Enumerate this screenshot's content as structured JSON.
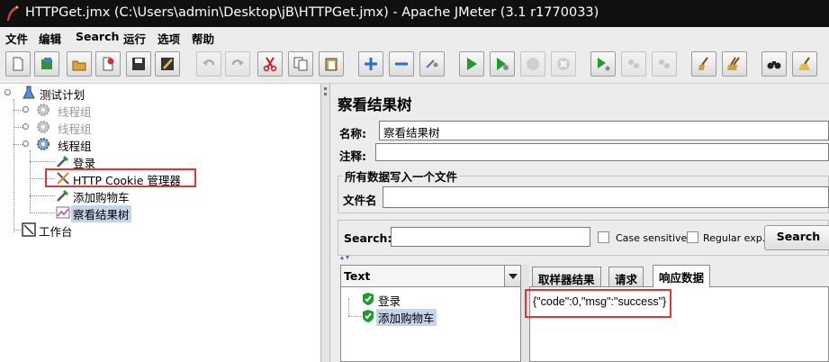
{
  "window": {
    "title": "HTTPGet.jmx (C:\\Users\\admin\\Desktop\\jB\\HTTPGet.jmx) - Apache JMeter (3.1 r1770033)"
  },
  "menu": [
    "文件",
    "编辑",
    "Search",
    "运行",
    "选项",
    "帮助"
  ],
  "toolbar": {
    "buttons": [
      "new-icon",
      "templates-icon",
      "open-icon",
      "close-icon",
      "save-icon",
      "save-as-icon",
      "undo-icon",
      "redo-icon",
      "cut-icon",
      "copy-icon",
      "paste-icon",
      "expand-icon",
      "collapse-icon",
      "toggle-icon",
      "start-icon",
      "start-no-pause-icon",
      "stop-icon",
      "shutdown-icon",
      "remote-start-icon",
      "remote-stop-icon",
      "remote-shutdown-icon",
      "clear-icon",
      "clear-all-icon",
      "search-icon",
      "reset-search-icon"
    ]
  },
  "tree": {
    "root": "测试计划",
    "items": [
      {
        "label": "线程组",
        "disabled": true
      },
      {
        "label": "线程组",
        "disabled": true
      },
      {
        "label": "线程组",
        "disabled": false
      },
      {
        "label": "登录"
      },
      {
        "label": "HTTP Cookie 管理器"
      },
      {
        "label": "添加购物车"
      },
      {
        "label": "察看结果树"
      }
    ],
    "workbench": "工作台"
  },
  "panel": {
    "title": "察看结果树",
    "name_label": "名称:",
    "name_value": "察看结果树",
    "comment_label": "注释:",
    "comment_value": "",
    "file_group_title": "所有数据写入一个文件",
    "filename_label": "文件名",
    "filename_value": ""
  },
  "search": {
    "label": "Search:",
    "value": "",
    "case_sensitive_label": "Case sensitive",
    "regex_label": "Regular exp.",
    "button_label": "Search"
  },
  "results": {
    "renderer": "Text",
    "samples": [
      {
        "label": "登录",
        "status": "success"
      },
      {
        "label": "添加购物车",
        "status": "success"
      }
    ],
    "tabs": [
      "取样器结果",
      "请求",
      "响应数据"
    ],
    "active_tab": "响应数据",
    "response_text": "{\"code\":0,\"msg\":\"success\"}"
  },
  "colors": {
    "highlight_box": "#d93a36",
    "selection": "#c5d4e8",
    "titlebar": "#101010"
  }
}
